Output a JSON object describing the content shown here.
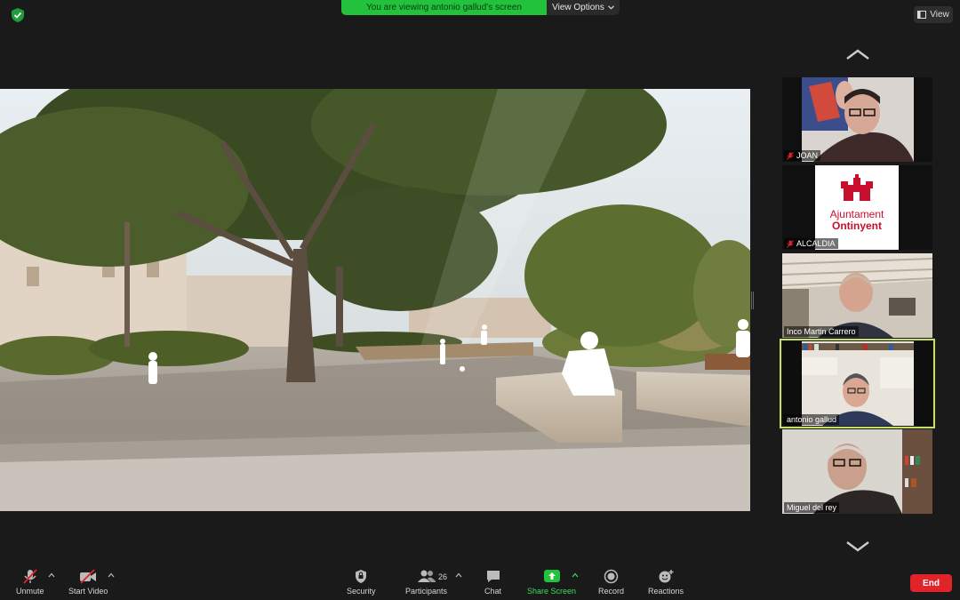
{
  "banner": {
    "text": "You are viewing antonio gallud's screen",
    "options_label": "View Options"
  },
  "view_button": {
    "label": "View"
  },
  "participants": [
    {
      "name": "JOAN",
      "muted": true
    },
    {
      "name": "ALCALDIA",
      "muted": true,
      "logo_line1": "Ajuntament",
      "logo_line2": "Ontinyent"
    },
    {
      "name": "Inco Martin Carrero",
      "muted": false
    },
    {
      "name": "antonio gallud",
      "muted": false,
      "active_speaker": true
    },
    {
      "name": "Miguel del rey",
      "muted": false
    }
  ],
  "toolbar": {
    "unmute": "Unmute",
    "start_video": "Start Video",
    "security": "Security",
    "participants": "Participants",
    "participants_count": "26",
    "chat": "Chat",
    "share_screen": "Share Screen",
    "record": "Record",
    "reactions": "Reactions",
    "end": "End"
  },
  "colors": {
    "share_green": "#22c23c",
    "end_red": "#e0242a",
    "active_border": "#c6df6a",
    "brand_red": "#c8102e"
  }
}
